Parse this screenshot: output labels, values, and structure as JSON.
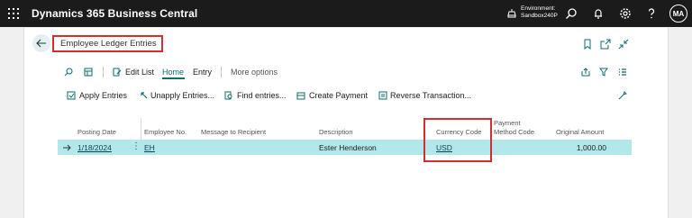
{
  "app": {
    "title": "Dynamics 365 Business Central",
    "environment_label": "Environment:",
    "environment_name": "Sandbox240P",
    "user_initials": "MA"
  },
  "page": {
    "title": "Employee Ledger Entries"
  },
  "action_bar": {
    "edit_list": "Edit List",
    "home": "Home",
    "entry": "Entry",
    "more_options": "More options"
  },
  "commands": {
    "apply_entries": "Apply Entries",
    "unapply_entries": "Unapply Entries...",
    "find_entries": "Find entries...",
    "create_payment": "Create Payment",
    "reverse_transaction": "Reverse Transaction..."
  },
  "grid": {
    "columns": {
      "posting_date": "Posting Date",
      "employee_no": "Employee No.",
      "message_to_recipient": "Message to Recipient",
      "description": "Description",
      "currency_code": "Currency Code",
      "payment_method_code_line1": "Payment",
      "payment_method_code_line2": "Method Code",
      "original_amount": "Original Amount"
    },
    "rows": [
      {
        "posting_date": "1/18/2024",
        "employee_no": "EH",
        "message_to_recipient": "",
        "description": "Ester Henderson",
        "currency_code": "USD",
        "payment_method_code": "",
        "original_amount": "1,000.00"
      }
    ]
  },
  "colors": {
    "app_bar": "#1b1b1b",
    "accent": "#0f6d6f",
    "selected_row": "#b2e8ea",
    "highlight_box": "#d32f2f"
  }
}
